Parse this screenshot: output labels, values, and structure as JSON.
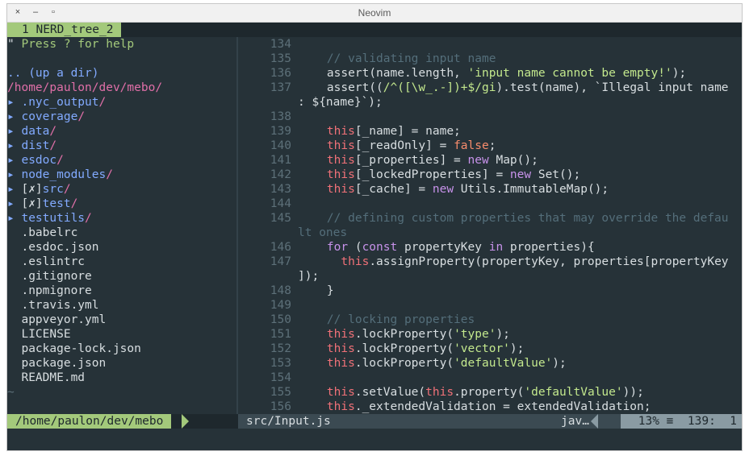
{
  "window": {
    "title": "Neovim",
    "controls": [
      "×",
      "–",
      "▫"
    ]
  },
  "tabline": {
    "active_tab": "1 NERD_tree_2"
  },
  "tree": {
    "help_marker": "\"",
    "help": " Press ? for help",
    "up": ".. (up a dir)",
    "root": "/home/paulon/dev/mebo/",
    "dirs": [
      {
        "arrow": "▸ ",
        "label": ".nyc_output",
        "slash": "/"
      },
      {
        "arrow": "▸ ",
        "label": "coverage",
        "slash": "/"
      },
      {
        "arrow": "▸ ",
        "label": "data",
        "slash": "/"
      },
      {
        "arrow": "▸ ",
        "label": "dist",
        "slash": "/"
      },
      {
        "arrow": "▸ ",
        "label": "esdoc",
        "slash": "/"
      },
      {
        "arrow": "▸ ",
        "label": "node_modules",
        "slash": "/"
      },
      {
        "arrow": "▸ ",
        "mark": "[✗]",
        "label": "src",
        "slash": "/"
      },
      {
        "arrow": "▸ ",
        "mark": "[✗]",
        "label": "test",
        "slash": "/"
      },
      {
        "arrow": "▸ ",
        "label": "testutils",
        "slash": "/"
      }
    ],
    "files": [
      ".babelrc",
      ".esdoc.json",
      ".eslintrc",
      ".gitignore",
      ".npmignore",
      ".travis.yml",
      "appveyor.yml",
      "LICENSE",
      "package-lock.json",
      "package.json",
      "README.md"
    ],
    "tilde": "~"
  },
  "code": {
    "lines": [
      {
        "n": "134",
        "t": []
      },
      {
        "n": "135",
        "t": [
          [
            "cmt",
            "    // validating input name"
          ]
        ]
      },
      {
        "n": "136",
        "t": [
          [
            "plain",
            "    assert(name.length, "
          ],
          [
            "str",
            "'input name cannot be empty!'"
          ],
          [
            "plain",
            ");"
          ]
        ]
      },
      {
        "n": "137",
        "t": [
          [
            "plain",
            "    assert(("
          ],
          [
            "str",
            "/^([\\w_.-])+$/gi"
          ],
          [
            "plain",
            ").test(name), `Illegal input name"
          ]
        ]
      },
      {
        "n": "",
        "t": [
          [
            "plain",
            ": ${name}`);"
          ]
        ]
      },
      {
        "n": "138",
        "t": []
      },
      {
        "n": "139",
        "t": [
          [
            "kw",
            "    this"
          ],
          [
            "plain",
            "[_name] = name;"
          ]
        ]
      },
      {
        "n": "140",
        "t": [
          [
            "kw",
            "    this"
          ],
          [
            "plain",
            "[_readOnly] = "
          ],
          [
            "bool",
            "false"
          ],
          [
            "plain",
            ";"
          ]
        ]
      },
      {
        "n": "141",
        "t": [
          [
            "kw",
            "    this"
          ],
          [
            "plain",
            "[_properties] = "
          ],
          [
            "kw2",
            "new"
          ],
          [
            "plain",
            " Map();"
          ]
        ]
      },
      {
        "n": "142",
        "t": [
          [
            "kw",
            "    this"
          ],
          [
            "plain",
            "[_lockedProperties] = "
          ],
          [
            "kw2",
            "new"
          ],
          [
            "plain",
            " Set();"
          ]
        ]
      },
      {
        "n": "143",
        "t": [
          [
            "kw",
            "    this"
          ],
          [
            "plain",
            "[_cache] = "
          ],
          [
            "kw2",
            "new"
          ],
          [
            "plain",
            " Utils.ImmutableMap();"
          ]
        ]
      },
      {
        "n": "144",
        "t": []
      },
      {
        "n": "145",
        "t": [
          [
            "cmt",
            "    // defining custom properties that may override the defau"
          ]
        ]
      },
      {
        "n": "",
        "t": [
          [
            "cmt",
            "lt ones"
          ]
        ]
      },
      {
        "n": "146",
        "t": [
          [
            "kw2",
            "    for"
          ],
          [
            "plain",
            " ("
          ],
          [
            "kw2",
            "const"
          ],
          [
            "plain",
            " propertyKey "
          ],
          [
            "kw2",
            "in"
          ],
          [
            "plain",
            " properties){"
          ]
        ]
      },
      {
        "n": "147",
        "t": [
          [
            "kw",
            "      this"
          ],
          [
            "plain",
            ".assignProperty(propertyKey, properties[propertyKey"
          ]
        ]
      },
      {
        "n": "",
        "t": [
          [
            "plain",
            "]);"
          ]
        ]
      },
      {
        "n": "148",
        "t": [
          [
            "plain",
            "    }"
          ]
        ]
      },
      {
        "n": "149",
        "t": []
      },
      {
        "n": "150",
        "t": [
          [
            "cmt",
            "    // locking properties"
          ]
        ]
      },
      {
        "n": "151",
        "t": [
          [
            "kw",
            "    this"
          ],
          [
            "plain",
            ".lockProperty("
          ],
          [
            "str",
            "'type'"
          ],
          [
            "plain",
            ");"
          ]
        ]
      },
      {
        "n": "152",
        "t": [
          [
            "kw",
            "    this"
          ],
          [
            "plain",
            ".lockProperty("
          ],
          [
            "str",
            "'vector'"
          ],
          [
            "plain",
            ");"
          ]
        ]
      },
      {
        "n": "153",
        "t": [
          [
            "kw",
            "    this"
          ],
          [
            "plain",
            ".lockProperty("
          ],
          [
            "str",
            "'defaultValue'"
          ],
          [
            "plain",
            ");"
          ]
        ]
      },
      {
        "n": "154",
        "t": []
      },
      {
        "n": "155",
        "t": [
          [
            "kw",
            "    this"
          ],
          [
            "plain",
            ".setValue("
          ],
          [
            "kw",
            "this"
          ],
          [
            "plain",
            ".property("
          ],
          [
            "str",
            "'defaultValue'"
          ],
          [
            "plain",
            "));"
          ]
        ]
      },
      {
        "n": "156",
        "t": [
          [
            "kw",
            "    this"
          ],
          [
            "plain",
            "._extendedValidation = extendedValidation;"
          ]
        ]
      }
    ]
  },
  "status": {
    "tree_path": "/home/paulon/dev/mebo",
    "file": "src/Input.js",
    "filetype": "jav…",
    "percent": "13%",
    "sep": "≡",
    "line": "139:",
    "col": "1"
  },
  "colors": {
    "background": "#263238",
    "accent_green": "#a3c97b",
    "keyword": "#f07178",
    "string": "#c3e88d",
    "comment": "#546e7a",
    "directory": "#82aaff",
    "path": "#e06fa8"
  }
}
